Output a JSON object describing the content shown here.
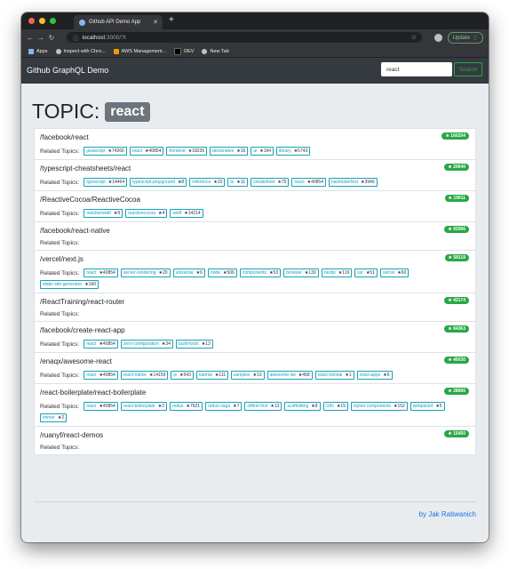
{
  "browser": {
    "tab_title": "Github API Demo App",
    "url_host": "localhost",
    "url_path": ":3000/?t",
    "update_label": "Update",
    "bookmarks": [
      {
        "label": "Apps",
        "color": "#8ab4f8"
      },
      {
        "label": "Inspect with Chro...",
        "color": "#bdc1c6"
      },
      {
        "label": "AWS Management...",
        "color": "#f29900"
      },
      {
        "label": "DEV",
        "color": "#000000"
      },
      {
        "label": "New Tab",
        "color": "#bdc1c6"
      }
    ]
  },
  "app": {
    "brand": "Github GraphQL Demo",
    "search_value": "react",
    "search_button": "Search",
    "topic_prefix": "TOPIC:",
    "topic": "react",
    "related_label": "Related Topics:",
    "footer_author": "by Jak Ratiwanich",
    "colors": {
      "star_badge": "#28a745",
      "chip": "#17a2b8",
      "navbar": "#343a40"
    }
  },
  "repos": [
    {
      "name": "/facebook/react",
      "stars": "★ 160204",
      "topics": [
        {
          "name": "javascript",
          "count": "★74266"
        },
        {
          "name": "react",
          "count": "★40854"
        },
        {
          "name": "frontend",
          "count": "★18236"
        },
        {
          "name": "declarative",
          "count": "★16"
        },
        {
          "name": "ui",
          "count": "★194"
        },
        {
          "name": "library",
          "count": "★5743"
        }
      ]
    },
    {
      "name": "/typescript-cheatsheets/react",
      "stars": "★ 20640",
      "topics": [
        {
          "name": "typescript",
          "count": "★14464"
        },
        {
          "name": "typescript-playground",
          "count": "★8"
        },
        {
          "name": "reference",
          "count": "★10"
        },
        {
          "name": "ts",
          "count": "★11"
        },
        {
          "name": "cheatsheet",
          "count": "★75"
        },
        {
          "name": "react",
          "count": "★40854"
        },
        {
          "name": "hacktoberfest",
          "count": "★3946"
        }
      ]
    },
    {
      "name": "/ReactiveCocoa/ReactiveCocoa",
      "stars": "★ 19911",
      "topics": [
        {
          "name": "reactiveswift",
          "count": "★9"
        },
        {
          "name": "reactivecocoa",
          "count": "★4"
        },
        {
          "name": "swift",
          "count": "★14214"
        }
      ]
    },
    {
      "name": "/facebook/react-native",
      "stars": "★ 92066",
      "topics": []
    },
    {
      "name": "/vercel/next.js",
      "stars": "★ 58119",
      "topics": [
        {
          "name": "react",
          "count": "★40854"
        },
        {
          "name": "server-rendering",
          "count": "★20"
        },
        {
          "name": "universal",
          "count": "★6"
        },
        {
          "name": "node",
          "count": "★506"
        },
        {
          "name": "components",
          "count": "★53"
        },
        {
          "name": "browser",
          "count": "★130"
        },
        {
          "name": "nextjs",
          "count": "★119"
        },
        {
          "name": "ssr",
          "count": "★51"
        },
        {
          "name": "vercel",
          "count": "★60"
        },
        {
          "name": "static-site-generator",
          "count": "★160"
        }
      ]
    },
    {
      "name": "/ReactTraining/react-router",
      "stars": "★ 42174",
      "topics": []
    },
    {
      "name": "/facebook/create-react-app",
      "stars": "★ 84363",
      "topics": [
        {
          "name": "react",
          "count": "★40854"
        },
        {
          "name": "zero-configuration",
          "count": "★34"
        },
        {
          "name": "build-tools",
          "count": "★13"
        }
      ]
    },
    {
      "name": "/enaqx/awesome-react",
      "stars": "★ 40030",
      "topics": [
        {
          "name": "react",
          "count": "★40854"
        },
        {
          "name": "react-native",
          "count": "★14159"
        },
        {
          "name": "js",
          "count": "★543"
        },
        {
          "name": "tutorial",
          "count": "★111"
        },
        {
          "name": "samples",
          "count": "★13"
        },
        {
          "name": "awesome-list",
          "count": "★458"
        },
        {
          "name": "react-tutorial",
          "count": "★1"
        },
        {
          "name": "react-apps",
          "count": "★6"
        }
      ]
    },
    {
      "name": "/react-boilerplate/react-boilerplate",
      "stars": "★ 28666",
      "topics": [
        {
          "name": "react",
          "count": "★40854"
        },
        {
          "name": "react-boilerplate",
          "count": "★3"
        },
        {
          "name": "redux",
          "count": "★7621"
        },
        {
          "name": "redux-saga",
          "count": "★7"
        },
        {
          "name": "offline-first",
          "count": "★13"
        },
        {
          "name": "scaffolding",
          "count": "★8"
        },
        {
          "name": "i18n",
          "count": "★15"
        },
        {
          "name": "styled-components",
          "count": "★152"
        },
        {
          "name": "webpack4",
          "count": "★5"
        },
        {
          "name": "immer",
          "count": "★2"
        }
      ]
    },
    {
      "name": "/ruanyf/react-demos",
      "stars": "★ 15450",
      "topics": []
    }
  ]
}
